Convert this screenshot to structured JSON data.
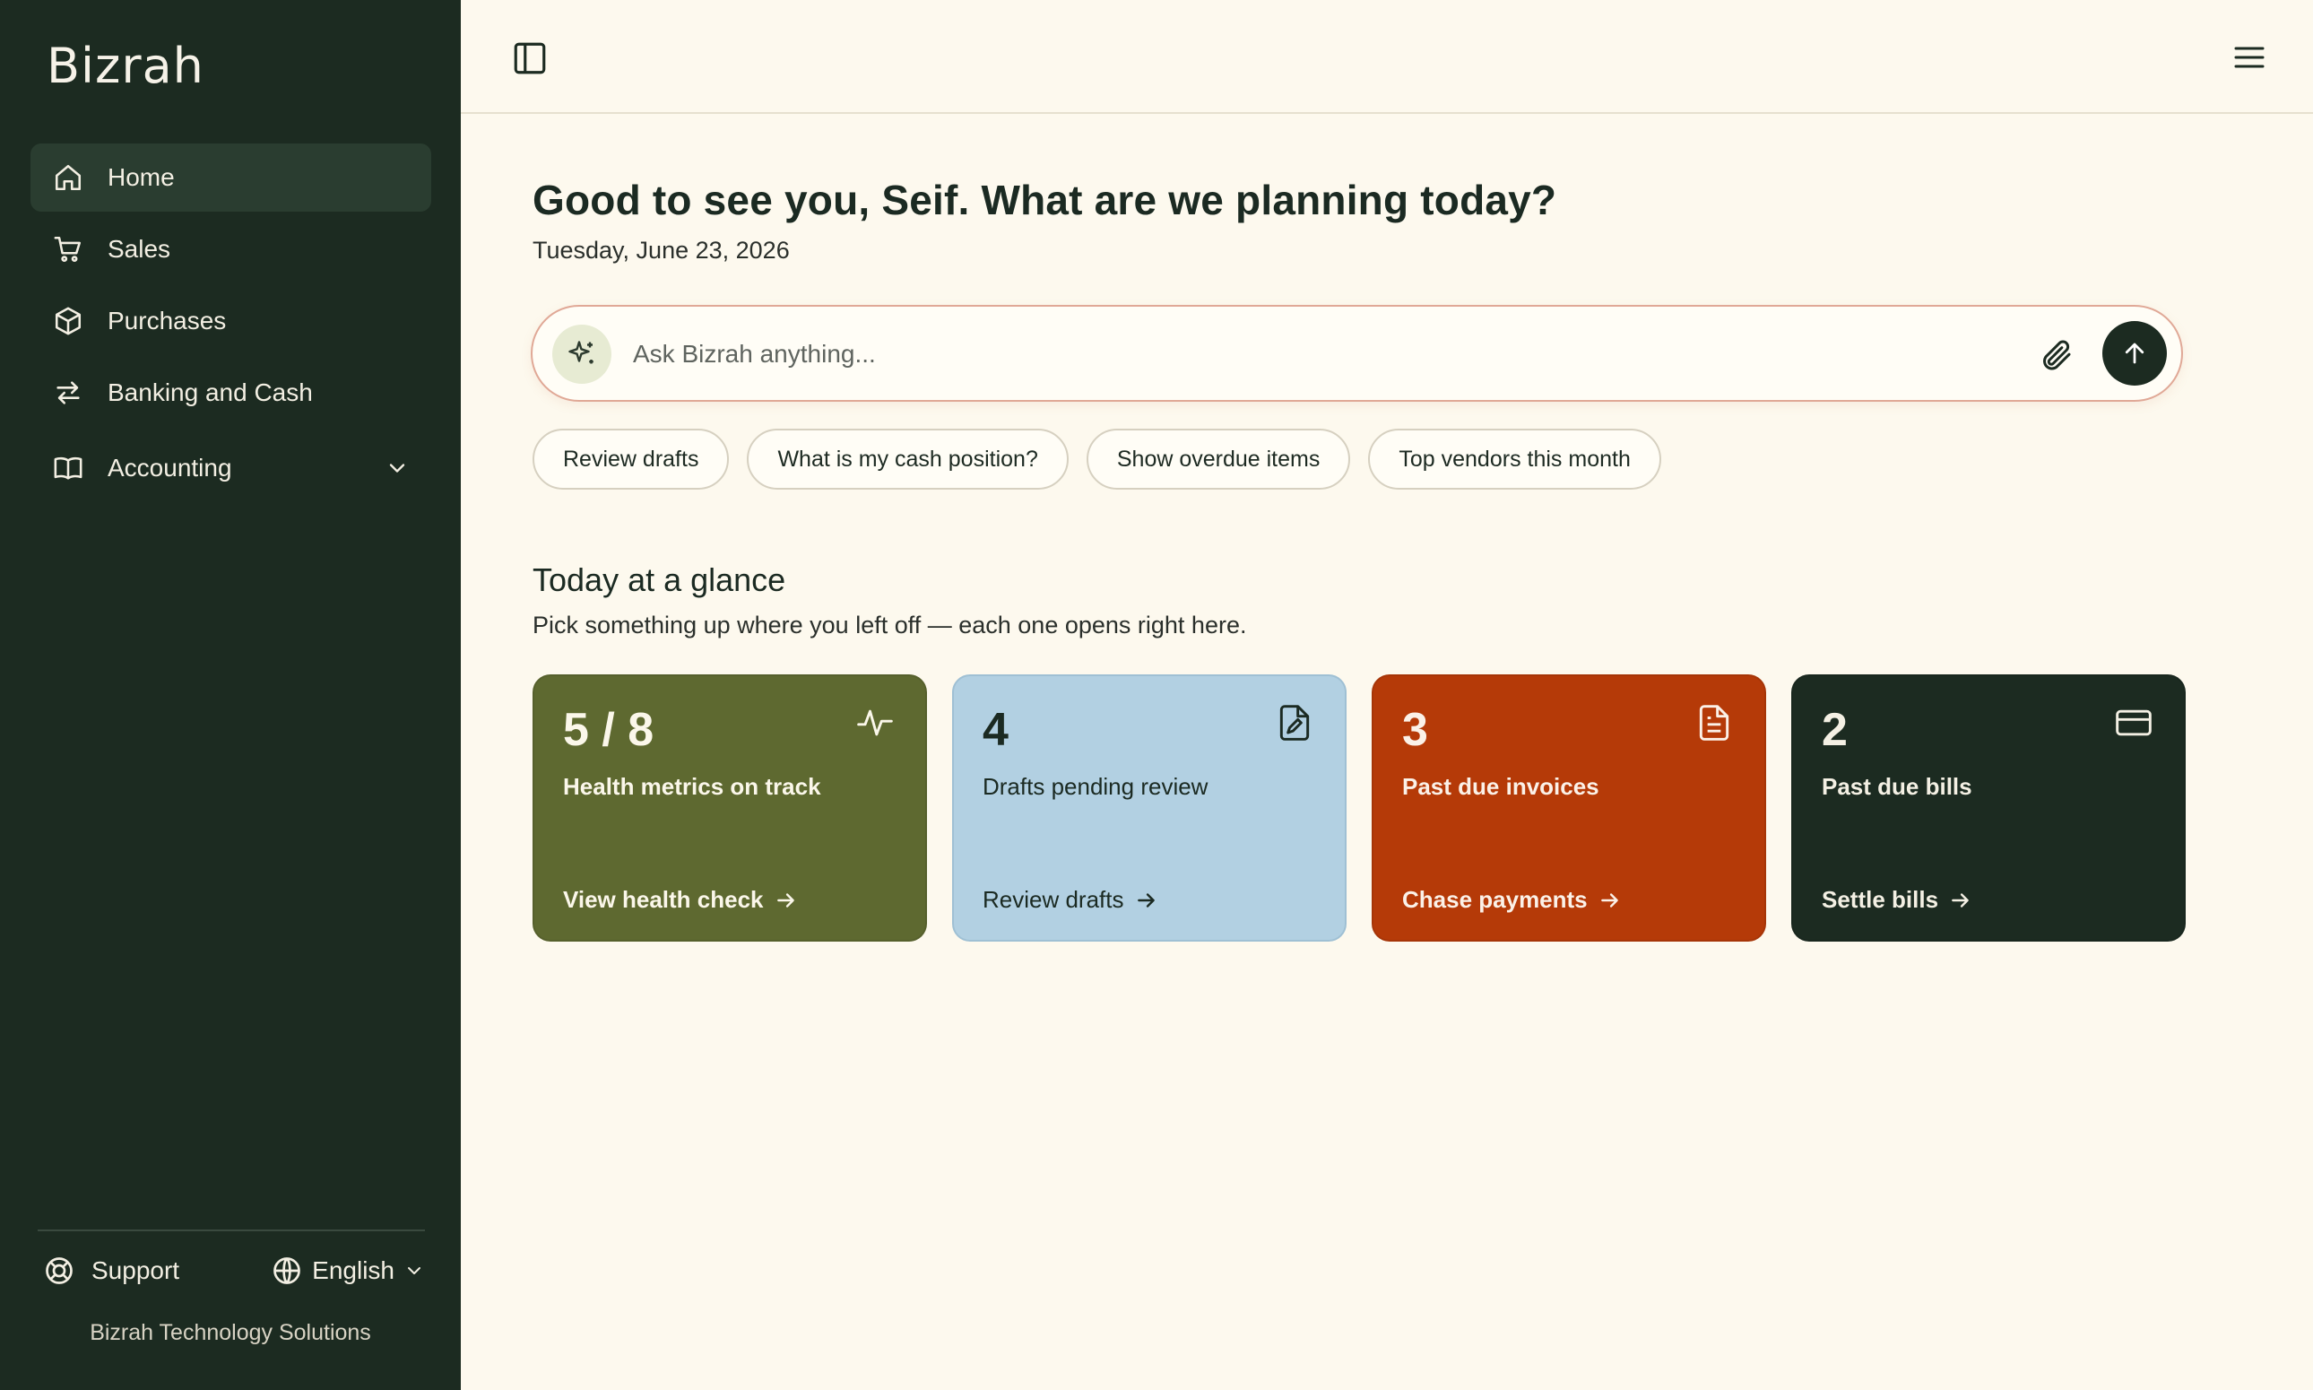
{
  "app": {
    "brand": "Bizrah"
  },
  "sidebar": {
    "items": [
      {
        "label": "Home",
        "icon": "home-icon",
        "active": true
      },
      {
        "label": "Sales",
        "icon": "cart-icon"
      },
      {
        "label": "Purchases",
        "icon": "box-icon"
      },
      {
        "label": "Banking and Cash",
        "icon": "transfer-icon"
      },
      {
        "label": "Accounting",
        "icon": "book-icon"
      }
    ],
    "support_label": "Support",
    "language_label": "English",
    "company": "Bizrah Technology Solutions"
  },
  "main": {
    "greeting": "Good to see you, Seif. What are we planning today?",
    "date": "Tuesday, June 23, 2026",
    "ask": {
      "placeholder": "Ask Bizrah anything..."
    },
    "chips": [
      "Review drafts",
      "What is my cash position?",
      "Show overdue items",
      "Top vendors this month"
    ],
    "glance": {
      "title": "Today at a glance",
      "subtitle": "Pick something up where you left off — each one opens right here."
    },
    "cards": [
      {
        "number": "5 / 8",
        "label": "Health metrics on track",
        "cta": "View health check",
        "icon": "pulse-icon",
        "color": "#5e6930"
      },
      {
        "number": "4",
        "label": "Drafts pending review",
        "cta": "Review drafts",
        "icon": "file-edit-icon",
        "color": "#b2d0e2"
      },
      {
        "number": "3",
        "label": "Past due invoices",
        "cta": "Chase payments",
        "icon": "document-icon",
        "color": "#b53a08"
      },
      {
        "number": "2",
        "label": "Past due bills",
        "cta": "Settle bills",
        "icon": "credit-card-icon",
        "color": "#1c2b21"
      }
    ]
  },
  "colors": {
    "sidebar_bg": "#1c2b21",
    "page_bg": "#fdf9ee",
    "accent_border": "#e0a896"
  }
}
